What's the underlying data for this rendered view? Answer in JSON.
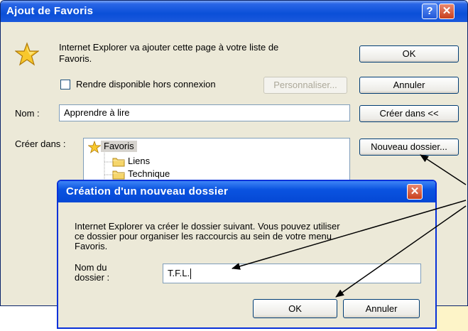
{
  "main_dialog": {
    "title": "Ajout de Favoris",
    "help_label": "?",
    "close_label": "✕",
    "info_text_line1": "Internet Explorer va ajouter cette page à votre liste de",
    "info_text_line2": "Favoris.",
    "offline_checkbox_label": "Rendre disponible hors connexion",
    "offline_checked": false,
    "customize_button": "Personnaliser...",
    "ok_button": "OK",
    "cancel_button": "Annuler",
    "name_label": "Nom :",
    "name_value": "Apprendre à lire",
    "create_in_button": "Créer dans <<",
    "create_in_label": "Créer dans :",
    "new_folder_button": "Nouveau dossier...",
    "tree": {
      "root": "Favoris",
      "children": [
        "Liens",
        "Technique"
      ]
    }
  },
  "new_folder_dialog": {
    "title": "Création d'un nouveau dossier",
    "close_label": "✕",
    "description_line1": "Internet Explorer va créer le dossier suivant. Vous pouvez utiliser",
    "description_line2": "ce dossier pour organiser les raccourcis au sein de votre menu",
    "description_line3": "Favoris.",
    "folder_name_label_line1": "Nom du",
    "folder_name_label_line2": "dossier :",
    "folder_name_value": "T.F.L.",
    "ok_button": "OK",
    "cancel_button": "Annuler"
  },
  "colors": {
    "titlebar_blue": "#0a4fd8",
    "dialog_face": "#ece9d8",
    "input_border": "#7f9db9",
    "close_red": "#c8401e"
  }
}
